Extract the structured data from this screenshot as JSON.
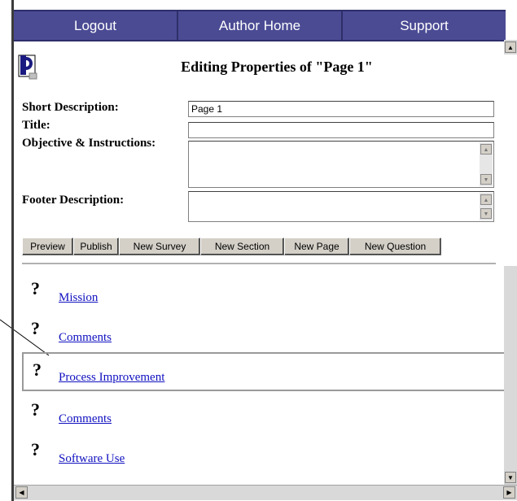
{
  "topnav": {
    "logout": "Logout",
    "author_home": "Author Home",
    "support": "Support"
  },
  "header": {
    "title": "Editing Properties of \"Page 1\""
  },
  "form": {
    "short_description": {
      "label": "Short Description:",
      "value": "Page 1"
    },
    "title": {
      "label": "Title:",
      "value": ""
    },
    "objective": {
      "label": "Objective & Instructions:",
      "value": ""
    },
    "footer": {
      "label": "Footer Description:",
      "value": ""
    }
  },
  "toolbar": {
    "preview": "Preview",
    "publish": "Publish",
    "new_survey": "New Survey",
    "new_section": "New Section",
    "new_page": "New Page",
    "new_question": "New Question"
  },
  "questions": [
    {
      "icon": "?",
      "label": "Mission"
    },
    {
      "icon": "?",
      "label": "Comments"
    },
    {
      "icon": "?",
      "label": "Process Improvement"
    },
    {
      "icon": "?",
      "label": "Comments"
    },
    {
      "icon": "?",
      "label": "Software Use"
    }
  ],
  "colors": {
    "nav_bg": "#4b4b94",
    "link": "#1010c0",
    "button_face": "#d4d0c8"
  }
}
